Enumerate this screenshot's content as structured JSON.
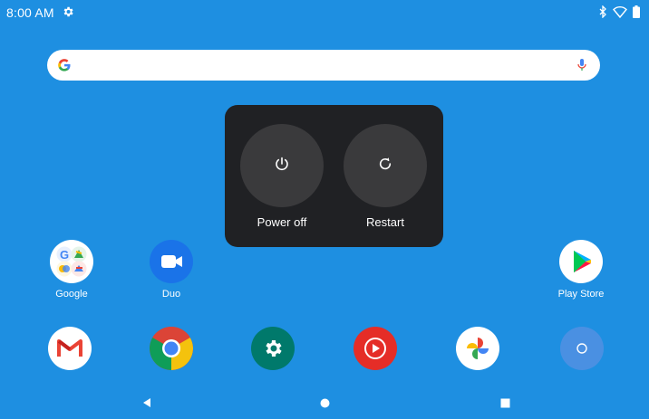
{
  "status_bar": {
    "time": "8:00 AM",
    "icons": [
      "settings-gear-icon",
      "bluetooth-icon",
      "wifi-icon",
      "battery-icon"
    ]
  },
  "search_bar": {
    "logo": "google-g-logo",
    "mic": "mic-icon"
  },
  "power_menu": {
    "power_off": {
      "label": "Power off",
      "icon": "power-icon"
    },
    "restart": {
      "label": "Restart",
      "icon": "restart-icon"
    }
  },
  "home_apps": [
    {
      "label": "Google",
      "icon": "google-folder-icon"
    },
    {
      "label": "Duo",
      "icon": "duo-icon"
    },
    {
      "label": "Play Store",
      "icon": "play-store-icon"
    }
  ],
  "dock": [
    {
      "icon": "gmail-icon"
    },
    {
      "icon": "chrome-icon"
    },
    {
      "icon": "settings-icon"
    },
    {
      "icon": "youtube-music-icon"
    },
    {
      "icon": "photos-icon"
    },
    {
      "icon": "app-drawer-icon"
    }
  ],
  "nav_bar": {
    "icons": [
      "back-icon",
      "home-icon",
      "recents-icon"
    ]
  },
  "colors": {
    "wallpaper": "#1e8fe1",
    "power_menu_bg": "#202124",
    "power_button_bg": "#3a3a3c"
  }
}
